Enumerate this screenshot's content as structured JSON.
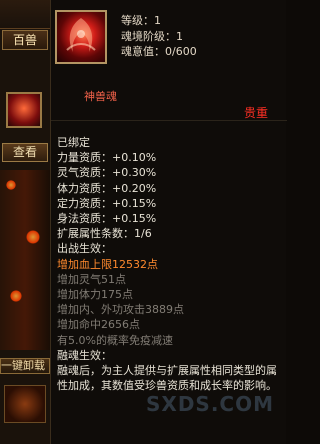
{
  "left": {
    "tab_label": "百兽",
    "view_label": "查看",
    "one_key_label": "一键卸载"
  },
  "item": {
    "header": [
      {
        "label": "等级：",
        "value": "1"
      },
      {
        "label": "魂境阶级：",
        "value": "1"
      },
      {
        "label": "魂意值：",
        "value": "0/600"
      }
    ],
    "name": "神兽魂",
    "rarity": "贵重"
  },
  "details": {
    "bound": "已绑定",
    "aptitudes": [
      {
        "label": "力量资质：",
        "value": "+0.10%"
      },
      {
        "label": "灵气资质：",
        "value": "+0.30%"
      },
      {
        "label": "体力资质：",
        "value": "+0.20%"
      },
      {
        "label": "定力资质：",
        "value": "+0.15%"
      },
      {
        "label": "身法资质：",
        "value": "+0.15%"
      },
      {
        "label": "扩展属性条数：",
        "value": "1/6"
      }
    ],
    "battle_title": "出战生效：",
    "battle_effects": [
      {
        "text": "增加血上限12532点",
        "active": true
      },
      {
        "text": "增加灵气51点",
        "active": false
      },
      {
        "text": "增加体力175点",
        "active": false
      },
      {
        "text": "增加内、外功攻击3889点",
        "active": false
      },
      {
        "text": "增加命中2656点",
        "active": false
      },
      {
        "text": "有5.0%的概率免疫减速",
        "active": false
      }
    ],
    "soul_title": "融魂生效：",
    "soul_desc": "融魂后，为主人提供与扩展属性相同类型的属性加成，其数值受珍兽资质和成长率的影响。"
  },
  "watermark": "SXDS.COM",
  "colors": {
    "rarity": "#ff2f24",
    "active_effect": "#ff8a2e",
    "inactive_effect": "#817c74"
  }
}
